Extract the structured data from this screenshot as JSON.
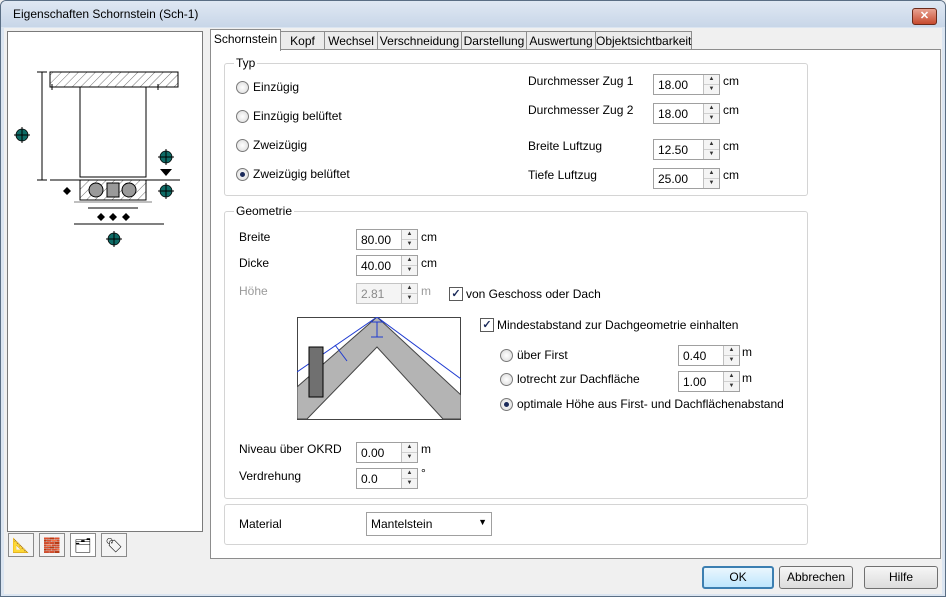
{
  "window": {
    "title": "Eigenschaften Schornstein (Sch-1)",
    "close_label": "✕"
  },
  "toolbar_icons": [
    "measure-icon",
    "material-icon",
    "layer-icon",
    "label-icon"
  ],
  "tabs": [
    "Schornstein",
    "Kopf",
    "Wechsel",
    "Verschneidung",
    "Darstellung",
    "Auswertung",
    "Objektsichtbarkeit"
  ],
  "typ": {
    "title": "Typ",
    "options": [
      "Einzügig",
      "Einzügig belüftet",
      "Zweizügig",
      "Zweizügig belüftet"
    ],
    "selected": "Zweizügig belüftet",
    "fields": [
      {
        "label": "Durchmesser Zug 1",
        "value": "18.00",
        "unit": "cm"
      },
      {
        "label": "Durchmesser Zug 2",
        "value": "18.00",
        "unit": "cm"
      },
      {
        "label": "Breite Luftzug",
        "value": "12.50",
        "unit": "cm"
      },
      {
        "label": "Tiefe Luftzug",
        "value": "25.00",
        "unit": "cm"
      }
    ]
  },
  "geometrie": {
    "title": "Geometrie",
    "breite": {
      "label": "Breite",
      "value": "80.00",
      "unit": "cm"
    },
    "dicke": {
      "label": "Dicke",
      "value": "40.00",
      "unit": "cm"
    },
    "hoehe": {
      "label": "Höhe",
      "value": "2.81",
      "unit": "m"
    },
    "von_geschoss": {
      "label": "von Geschoss oder Dach",
      "checked": true
    },
    "mindestabstand": {
      "label": "Mindestabstand zur Dachgeometrie einhalten",
      "checked": true
    },
    "ueber_first": {
      "label": "über First",
      "value": "0.40",
      "unit": "m"
    },
    "lotrecht": {
      "label": "lotrecht zur Dachfläche",
      "value": "1.00",
      "unit": "m"
    },
    "optimal": {
      "label": "optimale Höhe aus First- und Dachflächenabstand"
    },
    "niveau": {
      "label": "Niveau über OKRD",
      "value": "0.00",
      "unit": "m"
    },
    "verdrehung": {
      "label": "Verdrehung",
      "value": "0.0",
      "unit": "°"
    }
  },
  "material": {
    "label": "Material",
    "value": "Mantelstein"
  },
  "buttons": {
    "ok": "OK",
    "cancel": "Abbrechen",
    "help": "Hilfe"
  },
  "colors": {
    "accent": "#3c7fb1",
    "marker": "#0e6b66",
    "roof": "#b4b4b4"
  }
}
